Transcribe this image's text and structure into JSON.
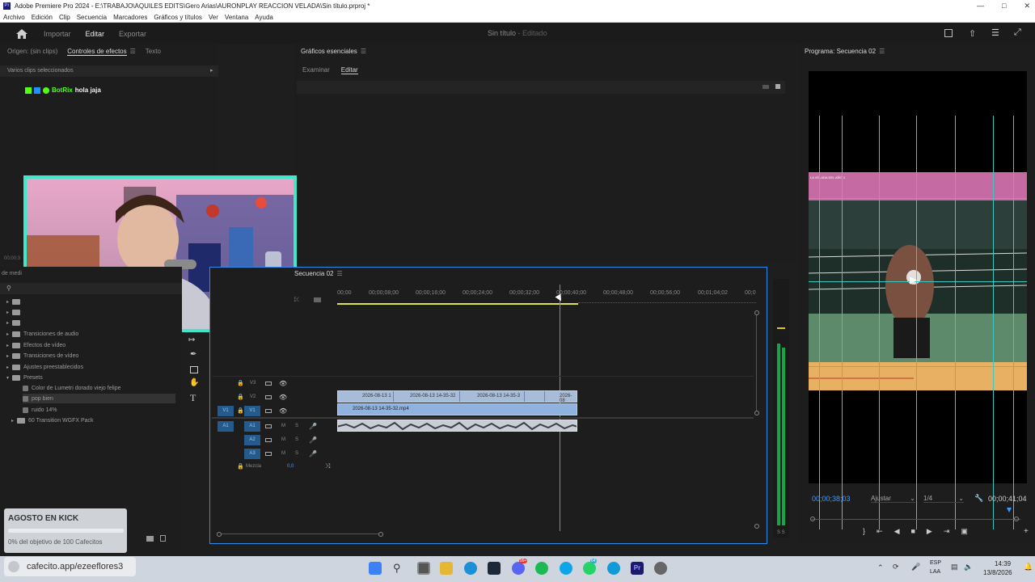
{
  "window": {
    "title": "Adobe Premiere Pro 2024 - E:\\TRABAJO\\AQUILES EDITS\\Gero Arias\\AURONPLAY REACCION VELADA\\Sin título.prproj *",
    "logo": "Pr"
  },
  "menu": [
    "Archivo",
    "Edición",
    "Clip",
    "Secuencia",
    "Marcadores",
    "Gráficos y títulos",
    "Ver",
    "Ventana",
    "Ayuda"
  ],
  "workspace": {
    "tabs": [
      "Importar",
      "Editar",
      "Exportar"
    ],
    "active": "Editar",
    "project_name": "Sin título",
    "project_status": "- Editado"
  },
  "left_panel": {
    "tabs": [
      "Origen: (sin clips)",
      "Controles de efectos",
      "Texto"
    ],
    "active_tab": "Controles de efectos",
    "subtitle": "Varios clips seleccionados",
    "chat_user": "BotRix",
    "chat_message": "hola jaja",
    "timecode_partial": "00;00;3"
  },
  "essential_graphics": {
    "title": "Gráficos esenciales",
    "tabs": [
      "Examinar",
      "Editar"
    ],
    "active_tab": "Editar"
  },
  "project_panel": {
    "tab_partial": "de medi",
    "items": [
      {
        "label": "Transiciones de audio",
        "type": "folder"
      },
      {
        "label": "Efectos de vídeo",
        "type": "folder"
      },
      {
        "label": "Transiciones de vídeo",
        "type": "folder"
      },
      {
        "label": "Ajustes preestablecidos",
        "type": "folder"
      },
      {
        "label": "Presets",
        "type": "folder"
      },
      {
        "label": "Color de Lumetri dorado viejo felipe",
        "type": "preset"
      },
      {
        "label": "pop bien",
        "type": "preset"
      },
      {
        "label": "ruido 14%",
        "type": "preset"
      },
      {
        "label": "60 Transition WGFX Pack",
        "type": "folder"
      }
    ]
  },
  "timeline": {
    "sequence_tab": "Secuencia 02",
    "ruler": [
      "00;00",
      "00;00;08;00",
      "00;00;16;00",
      "00;00;24;00",
      "00;00;32;00",
      "00;00;40;00",
      "00;00;48;00",
      "00;00;56;00",
      "00;01;04;02",
      "00;0"
    ],
    "tracks": [
      {
        "name": "V3",
        "type": "video"
      },
      {
        "name": "V2",
        "type": "video"
      },
      {
        "name": "V1",
        "type": "video",
        "source": "V1"
      },
      {
        "name": "A1",
        "type": "audio",
        "source": "A1"
      },
      {
        "name": "A2",
        "type": "audio"
      },
      {
        "name": "A3",
        "type": "audio"
      }
    ],
    "mix_label": "Mezcla",
    "mix_value": "0,0",
    "mute_label": "M",
    "solo_label": "S",
    "v2_clips": [
      "2026-08-13 1",
      "2026-08-13 14-35-32",
      "2026-08-13 14-35-3",
      "2026-08"
    ],
    "v1_clip": "2026-08-13 14-35-32.mp4",
    "meter_label": "S S"
  },
  "program_monitor": {
    "title": "Programa: Secuencia 02",
    "timecode": "00;00;38;03",
    "fit": "Ajustar",
    "resolution": "1/4",
    "duration": "00;00;41;04",
    "banner_text": "LA VELADA DEL AÑO 4"
  },
  "overlay": {
    "goal_title": "AGOSTO EN KICK",
    "goal_text": "0% del objetivo de 100 Cafecitos",
    "goal_progress": 0.0,
    "link": "cafecito.app/ezeeflores3"
  },
  "taskbar": {
    "lang": "ESP",
    "lang_sub": "LAA",
    "time": "14:39",
    "date": "13/8/2026",
    "badge1": "99+",
    "badge2": "64"
  },
  "colors": {
    "accent_blue": "#2d8ceb",
    "webcam_border": "#3ee8c8",
    "guide": "#3ec7c0",
    "playhead_tc": "#3b9bff"
  }
}
